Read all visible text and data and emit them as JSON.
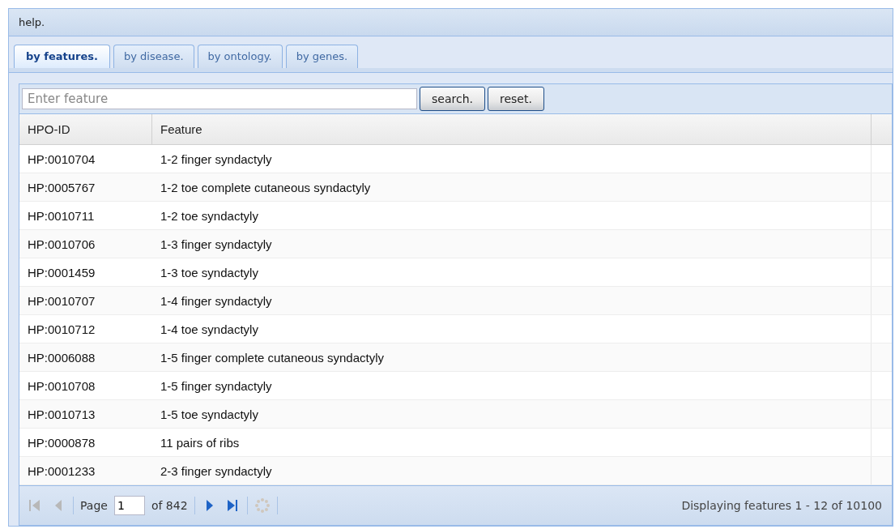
{
  "panel": {
    "title": "help."
  },
  "tabs": [
    {
      "label": "by features.",
      "selected": true
    },
    {
      "label": "by disease.",
      "selected": false
    },
    {
      "label": "by ontology.",
      "selected": false
    },
    {
      "label": "by genes.",
      "selected": false
    }
  ],
  "search": {
    "placeholder": "Enter feature"
  },
  "buttons": [
    "search.",
    "reset."
  ],
  "table": {
    "columns": [
      "HPO-ID",
      "Feature"
    ],
    "rows": [
      [
        "HP:0010704",
        "1-2 finger syndactyly"
      ],
      [
        "HP:0005767",
        "1-2 toe complete cutaneous syndactyly"
      ],
      [
        "HP:0010711",
        "1-2 toe syndactyly"
      ],
      [
        "HP:0010706",
        "1-3 finger syndactyly"
      ],
      [
        "HP:0001459",
        "1-3 toe syndactyly"
      ],
      [
        "HP:0010707",
        "1-4 finger syndactyly"
      ],
      [
        "HP:0010712",
        "1-4 toe syndactyly"
      ],
      [
        "HP:0006088",
        "1-5 finger complete cutaneous syndactyly"
      ],
      [
        "HP:0010708",
        "1-5 finger syndactyly"
      ],
      [
        "HP:0010713",
        "1-5 toe syndactyly"
      ],
      [
        "HP:0000878",
        "11 pairs of ribs"
      ],
      [
        "HP:0001233",
        "2-3 finger syndactyly"
      ]
    ]
  },
  "paging": {
    "first_disabled": true,
    "prev_disabled": true,
    "next_disabled": false,
    "last_disabled": false,
    "page_label": "Page",
    "page": "1",
    "of_label": "of 842",
    "status": "Displaying features 1 - 12 of 10100"
  }
}
